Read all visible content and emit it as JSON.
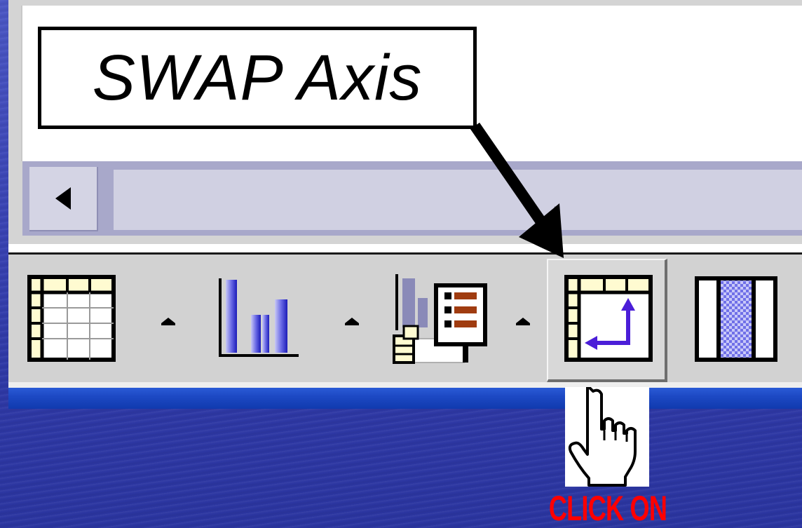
{
  "callout": {
    "label": "SWAP Axis"
  },
  "instruction": {
    "label": "CLICK ON"
  },
  "toolbar": {
    "buttons": [
      {
        "icon": "datasheet-grid-icon"
      },
      {
        "icon": "bar-chart-icon"
      },
      {
        "icon": "chart-with-datasheet-icon"
      },
      {
        "icon": "swap-axis-icon",
        "pressed": true
      },
      {
        "icon": "column-format-icon"
      }
    ]
  },
  "colors": {
    "background": "#3a44b4",
    "toolbar": "#d2d2d2",
    "instruction_text": "#ff0000",
    "icon_cell_yellow": "#fffbd1",
    "bar_blue": "#5a5ad8",
    "arrow_purple": "#4b1ed8"
  }
}
